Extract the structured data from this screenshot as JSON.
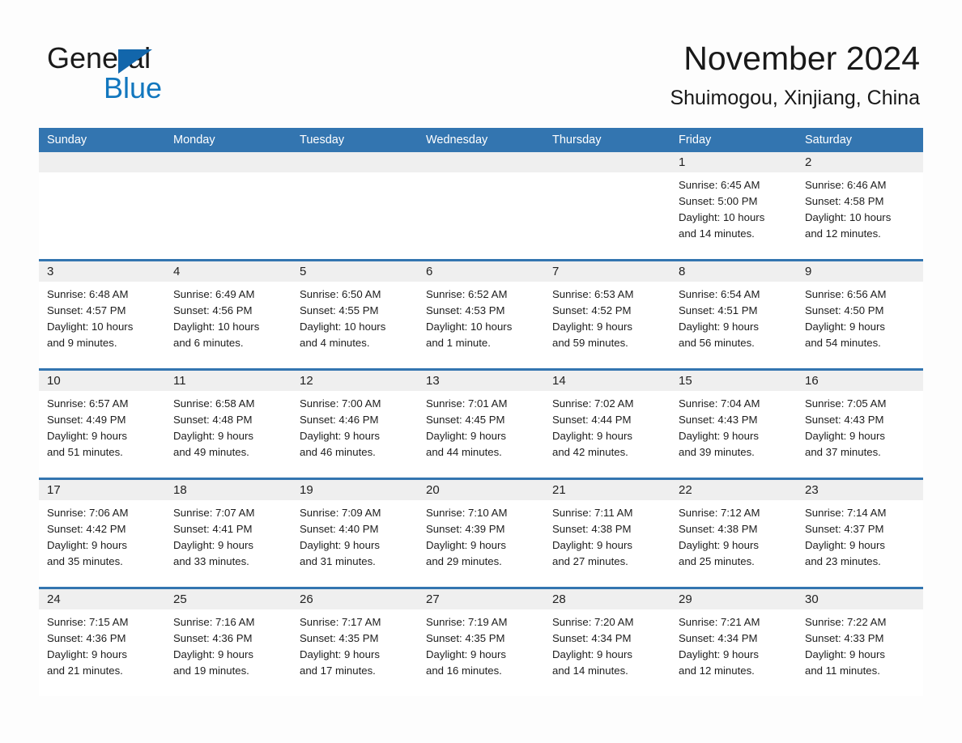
{
  "logo": {
    "text_top": "General",
    "text_bottom": "Blue",
    "triangle_color": "#1266ab",
    "blue_color": "#1277be"
  },
  "header": {
    "month_title": "November 2024",
    "location": "Shuimogou, Xinjiang, China"
  },
  "theme": {
    "header_blue": "#3375b0",
    "day_band_gray": "#efefef",
    "page_background": "#fdfdfd",
    "text_color": "#1a1a1a"
  },
  "weekdays": [
    "Sunday",
    "Monday",
    "Tuesday",
    "Wednesday",
    "Thursday",
    "Friday",
    "Saturday"
  ],
  "weeks": [
    [
      {
        "day": "",
        "lines": []
      },
      {
        "day": "",
        "lines": []
      },
      {
        "day": "",
        "lines": []
      },
      {
        "day": "",
        "lines": []
      },
      {
        "day": "",
        "lines": []
      },
      {
        "day": "1",
        "lines": [
          "Sunrise: 6:45 AM",
          "Sunset: 5:00 PM",
          "Daylight: 10 hours",
          "and 14 minutes."
        ]
      },
      {
        "day": "2",
        "lines": [
          "Sunrise: 6:46 AM",
          "Sunset: 4:58 PM",
          "Daylight: 10 hours",
          "and 12 minutes."
        ]
      }
    ],
    [
      {
        "day": "3",
        "lines": [
          "Sunrise: 6:48 AM",
          "Sunset: 4:57 PM",
          "Daylight: 10 hours",
          "and 9 minutes."
        ]
      },
      {
        "day": "4",
        "lines": [
          "Sunrise: 6:49 AM",
          "Sunset: 4:56 PM",
          "Daylight: 10 hours",
          "and 6 minutes."
        ]
      },
      {
        "day": "5",
        "lines": [
          "Sunrise: 6:50 AM",
          "Sunset: 4:55 PM",
          "Daylight: 10 hours",
          "and 4 minutes."
        ]
      },
      {
        "day": "6",
        "lines": [
          "Sunrise: 6:52 AM",
          "Sunset: 4:53 PM",
          "Daylight: 10 hours",
          "and 1 minute."
        ]
      },
      {
        "day": "7",
        "lines": [
          "Sunrise: 6:53 AM",
          "Sunset: 4:52 PM",
          "Daylight: 9 hours",
          "and 59 minutes."
        ]
      },
      {
        "day": "8",
        "lines": [
          "Sunrise: 6:54 AM",
          "Sunset: 4:51 PM",
          "Daylight: 9 hours",
          "and 56 minutes."
        ]
      },
      {
        "day": "9",
        "lines": [
          "Sunrise: 6:56 AM",
          "Sunset: 4:50 PM",
          "Daylight: 9 hours",
          "and 54 minutes."
        ]
      }
    ],
    [
      {
        "day": "10",
        "lines": [
          "Sunrise: 6:57 AM",
          "Sunset: 4:49 PM",
          "Daylight: 9 hours",
          "and 51 minutes."
        ]
      },
      {
        "day": "11",
        "lines": [
          "Sunrise: 6:58 AM",
          "Sunset: 4:48 PM",
          "Daylight: 9 hours",
          "and 49 minutes."
        ]
      },
      {
        "day": "12",
        "lines": [
          "Sunrise: 7:00 AM",
          "Sunset: 4:46 PM",
          "Daylight: 9 hours",
          "and 46 minutes."
        ]
      },
      {
        "day": "13",
        "lines": [
          "Sunrise: 7:01 AM",
          "Sunset: 4:45 PM",
          "Daylight: 9 hours",
          "and 44 minutes."
        ]
      },
      {
        "day": "14",
        "lines": [
          "Sunrise: 7:02 AM",
          "Sunset: 4:44 PM",
          "Daylight: 9 hours",
          "and 42 minutes."
        ]
      },
      {
        "day": "15",
        "lines": [
          "Sunrise: 7:04 AM",
          "Sunset: 4:43 PM",
          "Daylight: 9 hours",
          "and 39 minutes."
        ]
      },
      {
        "day": "16",
        "lines": [
          "Sunrise: 7:05 AM",
          "Sunset: 4:43 PM",
          "Daylight: 9 hours",
          "and 37 minutes."
        ]
      }
    ],
    [
      {
        "day": "17",
        "lines": [
          "Sunrise: 7:06 AM",
          "Sunset: 4:42 PM",
          "Daylight: 9 hours",
          "and 35 minutes."
        ]
      },
      {
        "day": "18",
        "lines": [
          "Sunrise: 7:07 AM",
          "Sunset: 4:41 PM",
          "Daylight: 9 hours",
          "and 33 minutes."
        ]
      },
      {
        "day": "19",
        "lines": [
          "Sunrise: 7:09 AM",
          "Sunset: 4:40 PM",
          "Daylight: 9 hours",
          "and 31 minutes."
        ]
      },
      {
        "day": "20",
        "lines": [
          "Sunrise: 7:10 AM",
          "Sunset: 4:39 PM",
          "Daylight: 9 hours",
          "and 29 minutes."
        ]
      },
      {
        "day": "21",
        "lines": [
          "Sunrise: 7:11 AM",
          "Sunset: 4:38 PM",
          "Daylight: 9 hours",
          "and 27 minutes."
        ]
      },
      {
        "day": "22",
        "lines": [
          "Sunrise: 7:12 AM",
          "Sunset: 4:38 PM",
          "Daylight: 9 hours",
          "and 25 minutes."
        ]
      },
      {
        "day": "23",
        "lines": [
          "Sunrise: 7:14 AM",
          "Sunset: 4:37 PM",
          "Daylight: 9 hours",
          "and 23 minutes."
        ]
      }
    ],
    [
      {
        "day": "24",
        "lines": [
          "Sunrise: 7:15 AM",
          "Sunset: 4:36 PM",
          "Daylight: 9 hours",
          "and 21 minutes."
        ]
      },
      {
        "day": "25",
        "lines": [
          "Sunrise: 7:16 AM",
          "Sunset: 4:36 PM",
          "Daylight: 9 hours",
          "and 19 minutes."
        ]
      },
      {
        "day": "26",
        "lines": [
          "Sunrise: 7:17 AM",
          "Sunset: 4:35 PM",
          "Daylight: 9 hours",
          "and 17 minutes."
        ]
      },
      {
        "day": "27",
        "lines": [
          "Sunrise: 7:19 AM",
          "Sunset: 4:35 PM",
          "Daylight: 9 hours",
          "and 16 minutes."
        ]
      },
      {
        "day": "28",
        "lines": [
          "Sunrise: 7:20 AM",
          "Sunset: 4:34 PM",
          "Daylight: 9 hours",
          "and 14 minutes."
        ]
      },
      {
        "day": "29",
        "lines": [
          "Sunrise: 7:21 AM",
          "Sunset: 4:34 PM",
          "Daylight: 9 hours",
          "and 12 minutes."
        ]
      },
      {
        "day": "30",
        "lines": [
          "Sunrise: 7:22 AM",
          "Sunset: 4:33 PM",
          "Daylight: 9 hours",
          "and 11 minutes."
        ]
      }
    ]
  ]
}
